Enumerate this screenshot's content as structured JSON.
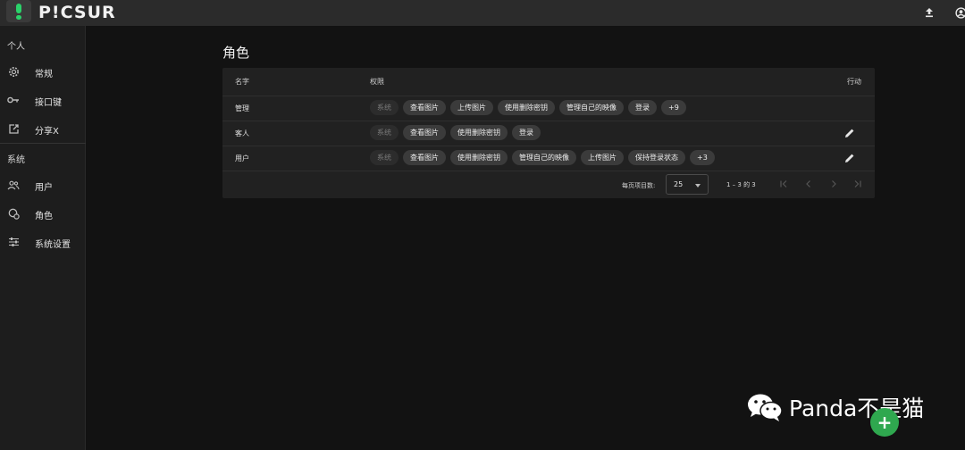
{
  "app": {
    "logo_text": "P!CSUR"
  },
  "topbar": {
    "upload_icon": "upload-icon",
    "account_icon": "account-icon"
  },
  "sidebar": {
    "section_personal": "个人",
    "section_system": "系统",
    "items": [
      {
        "label": "常规",
        "icon": "gear-icon"
      },
      {
        "label": "接口键",
        "icon": "key-icon"
      },
      {
        "label": "分享X",
        "icon": "share-icon"
      },
      {
        "label": "用户",
        "icon": "users-icon"
      },
      {
        "label": "角色",
        "icon": "roles-icon"
      },
      {
        "label": "系统设置",
        "icon": "sliders-icon"
      }
    ]
  },
  "page": {
    "title": "角色"
  },
  "table": {
    "headers": {
      "name": "名字",
      "permissions": "权限",
      "actions": "行动"
    },
    "rows": [
      {
        "name": "管理",
        "chips": [
          "系统",
          "查看图片",
          "上传图片",
          "使用删除密钥",
          "管理自己的映像",
          "登录",
          "+9"
        ],
        "editable": false
      },
      {
        "name": "客人",
        "chips": [
          "系统",
          "查看图片",
          "使用删除密钥",
          "登录"
        ],
        "editable": true
      },
      {
        "name": "用户",
        "chips": [
          "系统",
          "查看图片",
          "使用删除密钥",
          "管理自己的映像",
          "上传图片",
          "保持登录状态",
          "+3"
        ],
        "editable": true
      }
    ]
  },
  "pagination": {
    "items_per_page_label": "每页项目数:",
    "page_size": "25",
    "range": "1 – 3 的 3"
  },
  "watermark": {
    "text": "Panda不是猫"
  },
  "fab": {
    "label": "+"
  },
  "colors": {
    "accent": "#2fa84f",
    "logo_green": "#2bd26a",
    "background": "#121212",
    "surface": "#212121"
  }
}
